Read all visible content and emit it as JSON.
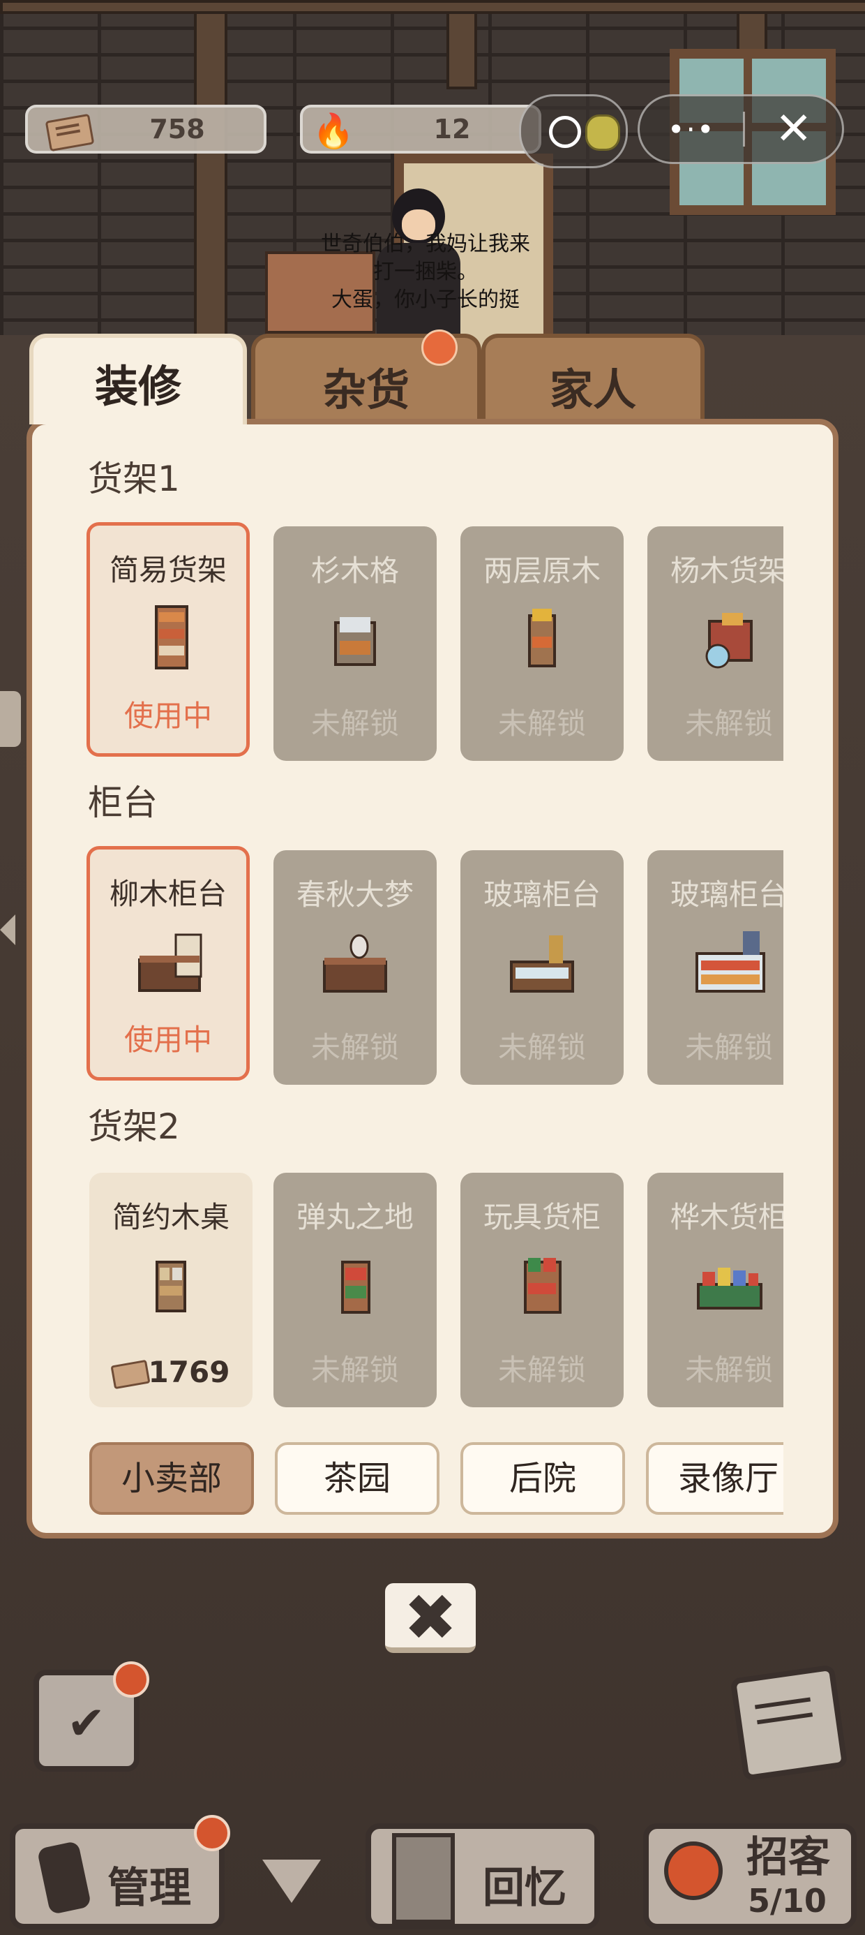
{
  "hud": {
    "money": "758",
    "fire": "12",
    "menu_more": "•·•",
    "menu_close": "✕"
  },
  "scene": {
    "speech_line1": "世奇伯伯，我妈让我来",
    "speech_line2": "打一捆柴。",
    "speech_line3": "大蛋，你小子长的挺"
  },
  "tabs": [
    {
      "label": "装修",
      "active": true
    },
    {
      "label": "杂货",
      "active": false,
      "badge": true
    },
    {
      "label": "家人",
      "active": false
    }
  ],
  "sections": [
    {
      "title": "货架1",
      "items": [
        {
          "name": "简易货架",
          "status": "使用中",
          "state": "selected"
        },
        {
          "name": "杉木格",
          "status": "未解锁",
          "state": "locked"
        },
        {
          "name": "两层原木",
          "status": "未解锁",
          "state": "locked"
        },
        {
          "name": "杨木货架",
          "status": "未解锁",
          "state": "locked"
        }
      ]
    },
    {
      "title": "柜台",
      "items": [
        {
          "name": "柳木柜台",
          "status": "使用中",
          "state": "selected"
        },
        {
          "name": "春秋大梦",
          "status": "未解锁",
          "state": "locked"
        },
        {
          "name": "玻璃柜台",
          "status": "未解锁",
          "state": "locked"
        },
        {
          "name": "玻璃柜台",
          "status": "未解锁",
          "state": "locked"
        }
      ]
    },
    {
      "title": "货架2",
      "items": [
        {
          "name": "简约木桌",
          "status": "1769",
          "state": "buy"
        },
        {
          "name": "弹丸之地",
          "status": "未解锁",
          "state": "locked"
        },
        {
          "name": "玩具货柜",
          "status": "未解锁",
          "state": "locked"
        },
        {
          "name": "桦木货柜",
          "status": "未解锁",
          "state": "locked"
        }
      ]
    }
  ],
  "locations": [
    {
      "label": "小卖部",
      "active": true
    },
    {
      "label": "茶园",
      "active": false
    },
    {
      "label": "后院",
      "active": false
    },
    {
      "label": "录像厅",
      "active": false
    }
  ],
  "close_label": "✖",
  "bottom": {
    "manage": "管理",
    "memory": "回忆",
    "invite": "招客",
    "invite_count": "5/10"
  },
  "colors": {
    "selected_border": "#e3704c",
    "panel_bg": "#f8f0e2",
    "locked_card": "#aca293",
    "badge": "#d4552e"
  },
  "icons": [
    "money-icon",
    "fire-icon",
    "pacman-icon",
    "coin-icon",
    "more-icon",
    "close-icon",
    "calendar-icon",
    "notepad-icon",
    "phone-hammer-icon",
    "film-icon",
    "rattle-drum-icon"
  ]
}
